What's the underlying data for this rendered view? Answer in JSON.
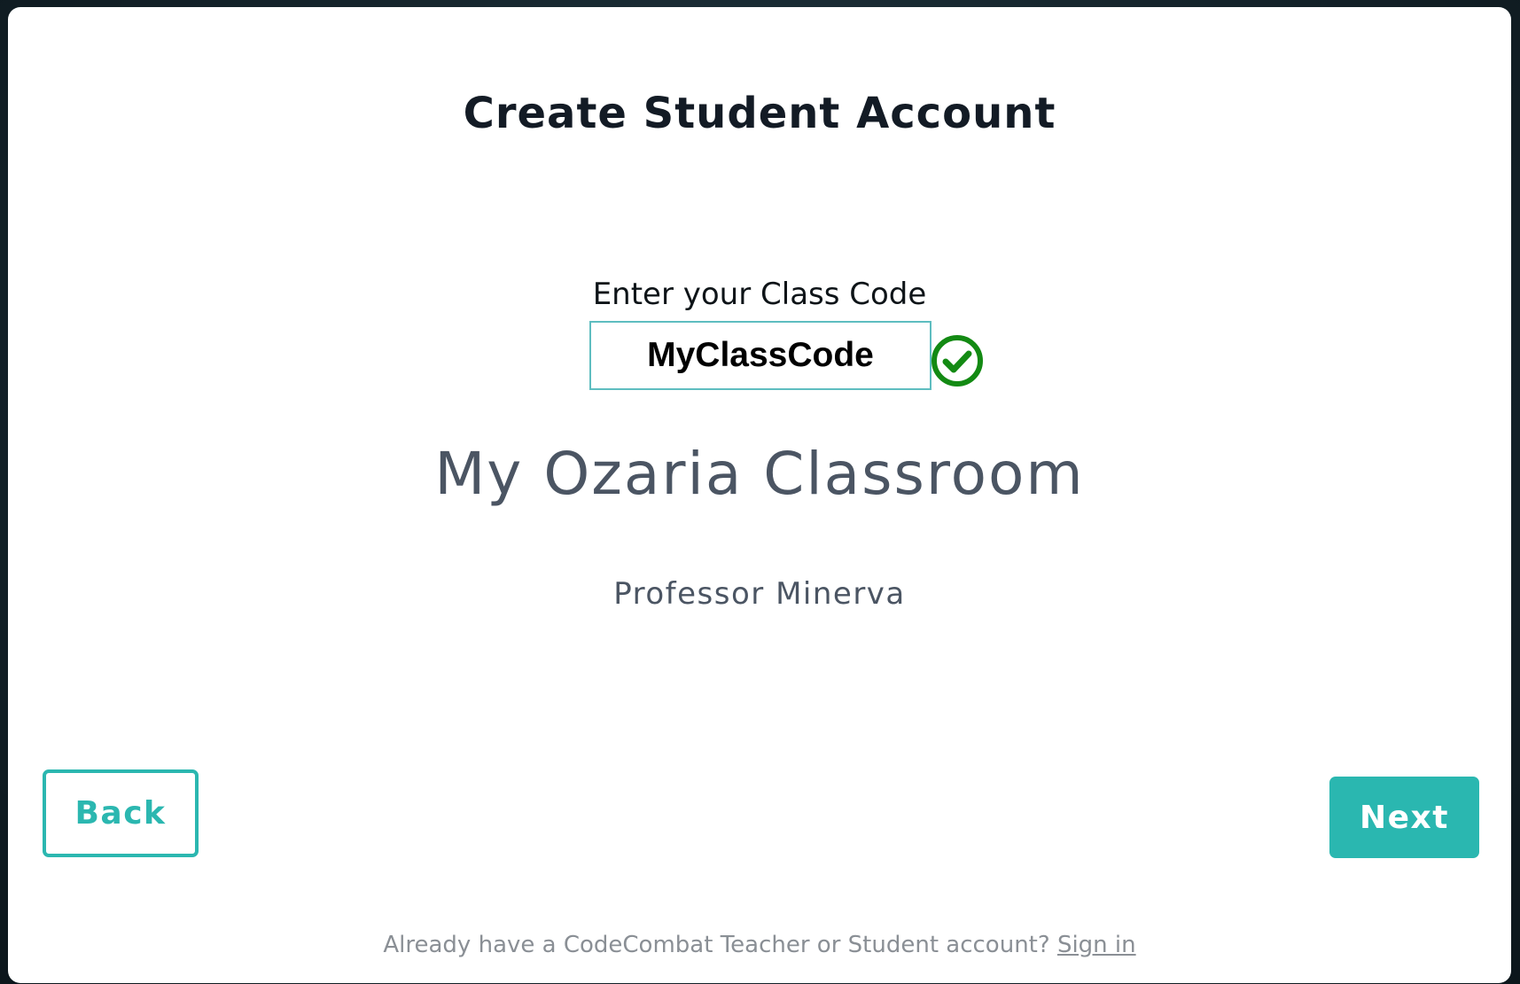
{
  "modal": {
    "title": "Create Student Account",
    "class_code": {
      "label": "Enter your Class Code",
      "value": "MyClassCode",
      "status_icon": "check-circle-icon",
      "status_color": "#138a13"
    },
    "class_name": "My Ozaria Classroom",
    "teacher_name": "Professor Minerva",
    "buttons": {
      "back_label": "Back",
      "next_label": "Next"
    },
    "footer": {
      "prompt": "Already have a CodeCombat Teacher or Student account?",
      "sign_in_label": "Sign in"
    }
  },
  "colors": {
    "accent": "#2bb7b0",
    "input_border": "#5ebdc0",
    "title_text": "#131b25",
    "muted_text": "#4b5563",
    "footer_text": "#8a8f95"
  }
}
